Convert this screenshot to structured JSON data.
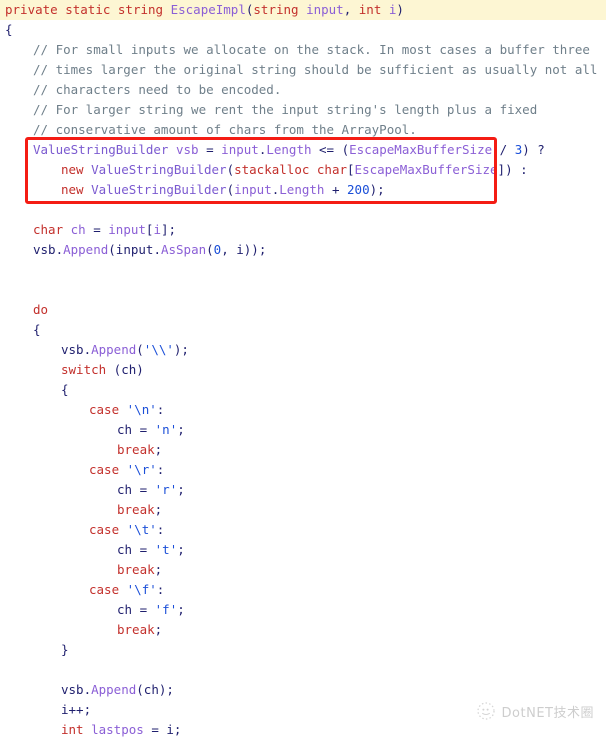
{
  "editor": {
    "language": "csharp",
    "background": "#ffffff",
    "current_line_highlight_color": "#fdf6d3",
    "annotation_box_color": "#f41c14",
    "colors": {
      "keyword": "#c3302c",
      "type": "#7b5ad0",
      "identifier": "#8b5fd6",
      "number": "#1b4fd8",
      "string": "#1b4fd8",
      "comment": "#6f7f8a",
      "punctuation": "#1f1f6e"
    }
  },
  "lines": [
    {
      "highlighted": true,
      "indent": 0,
      "tokens": [
        {
          "t": "private",
          "c": "kw"
        },
        {
          "t": " ",
          "c": "plain"
        },
        {
          "t": "static",
          "c": "kw"
        },
        {
          "t": " ",
          "c": "plain"
        },
        {
          "t": "string",
          "c": "kw"
        },
        {
          "t": " ",
          "c": "plain"
        },
        {
          "t": "EscapeImpl",
          "c": "method"
        },
        {
          "t": "(",
          "c": "punct"
        },
        {
          "t": "string",
          "c": "kw"
        },
        {
          "t": " ",
          "c": "plain"
        },
        {
          "t": "input",
          "c": "ident"
        },
        {
          "t": ", ",
          "c": "punct"
        },
        {
          "t": "int",
          "c": "kw"
        },
        {
          "t": " ",
          "c": "plain"
        },
        {
          "t": "i",
          "c": "ident"
        },
        {
          "t": ")",
          "c": "punct"
        }
      ]
    },
    {
      "highlighted": false,
      "indent": 0,
      "tokens": [
        {
          "t": "{",
          "c": "punct"
        }
      ]
    },
    {
      "highlighted": false,
      "indent": 1,
      "tokens": [
        {
          "t": "// For small inputs we allocate on the stack. In most cases a buffer three",
          "c": "comment"
        }
      ]
    },
    {
      "highlighted": false,
      "indent": 1,
      "tokens": [
        {
          "t": "// times larger the original string should be sufficient as usually not all",
          "c": "comment"
        }
      ]
    },
    {
      "highlighted": false,
      "indent": 1,
      "tokens": [
        {
          "t": "// characters need to be encoded.",
          "c": "comment"
        }
      ]
    },
    {
      "highlighted": false,
      "indent": 1,
      "tokens": [
        {
          "t": "// For larger string we rent the input string's length plus a fixed",
          "c": "comment"
        }
      ]
    },
    {
      "highlighted": false,
      "indent": 1,
      "tokens": [
        {
          "t": "// conservative amount of chars from the ArrayPool.",
          "c": "comment"
        }
      ]
    },
    {
      "highlighted": false,
      "indent": 1,
      "tokens": [
        {
          "t": "ValueStringBuilder",
          "c": "type"
        },
        {
          "t": " ",
          "c": "plain"
        },
        {
          "t": "vsb",
          "c": "ident"
        },
        {
          "t": " ",
          "c": "plain"
        },
        {
          "t": "=",
          "c": "punct"
        },
        {
          "t": " ",
          "c": "plain"
        },
        {
          "t": "input",
          "c": "ident"
        },
        {
          "t": ".",
          "c": "punct"
        },
        {
          "t": "Length",
          "c": "ident"
        },
        {
          "t": " <= (",
          "c": "punct"
        },
        {
          "t": "EscapeMaxBufferSize",
          "c": "ident"
        },
        {
          "t": " / ",
          "c": "punct"
        },
        {
          "t": "3",
          "c": "num"
        },
        {
          "t": ") ?",
          "c": "punct"
        }
      ]
    },
    {
      "highlighted": false,
      "indent": 2,
      "tokens": [
        {
          "t": "new",
          "c": "kw"
        },
        {
          "t": " ",
          "c": "plain"
        },
        {
          "t": "ValueStringBuilder",
          "c": "type"
        },
        {
          "t": "(",
          "c": "punct"
        },
        {
          "t": "stackalloc",
          "c": "kw"
        },
        {
          "t": " ",
          "c": "plain"
        },
        {
          "t": "char",
          "c": "kw"
        },
        {
          "t": "[",
          "c": "punct"
        },
        {
          "t": "EscapeMaxBufferSize",
          "c": "ident"
        },
        {
          "t": "]) :",
          "c": "punct"
        }
      ]
    },
    {
      "highlighted": false,
      "indent": 2,
      "tokens": [
        {
          "t": "new",
          "c": "kw"
        },
        {
          "t": " ",
          "c": "plain"
        },
        {
          "t": "ValueStringBuilder",
          "c": "type"
        },
        {
          "t": "(",
          "c": "punct"
        },
        {
          "t": "input",
          "c": "ident"
        },
        {
          "t": ".",
          "c": "punct"
        },
        {
          "t": "Length",
          "c": "ident"
        },
        {
          "t": " + ",
          "c": "punct"
        },
        {
          "t": "200",
          "c": "num"
        },
        {
          "t": ");",
          "c": "punct"
        }
      ]
    },
    {
      "highlighted": false,
      "indent": 0,
      "tokens": [
        {
          "t": "",
          "c": "plain"
        }
      ]
    },
    {
      "highlighted": false,
      "indent": 1,
      "tokens": [
        {
          "t": "char",
          "c": "kw"
        },
        {
          "t": " ",
          "c": "plain"
        },
        {
          "t": "ch",
          "c": "ident"
        },
        {
          "t": " = ",
          "c": "punct"
        },
        {
          "t": "input",
          "c": "ident"
        },
        {
          "t": "[",
          "c": "punct"
        },
        {
          "t": "i",
          "c": "ident"
        },
        {
          "t": "];",
          "c": "punct"
        }
      ]
    },
    {
      "highlighted": false,
      "indent": 1,
      "tokens": [
        {
          "t": "vsb",
          "c": "plain"
        },
        {
          "t": ".",
          "c": "punct"
        },
        {
          "t": "Append",
          "c": "method"
        },
        {
          "t": "(",
          "c": "punct"
        },
        {
          "t": "input",
          "c": "plain"
        },
        {
          "t": ".",
          "c": "punct"
        },
        {
          "t": "AsSpan",
          "c": "method"
        },
        {
          "t": "(",
          "c": "punct"
        },
        {
          "t": "0",
          "c": "num"
        },
        {
          "t": ", ",
          "c": "punct"
        },
        {
          "t": "i",
          "c": "plain"
        },
        {
          "t": "));",
          "c": "punct"
        }
      ]
    },
    {
      "highlighted": false,
      "indent": 0,
      "tokens": [
        {
          "t": "",
          "c": "plain"
        }
      ]
    },
    {
      "highlighted": false,
      "indent": 0,
      "tokens": [
        {
          "t": "",
          "c": "plain"
        }
      ]
    },
    {
      "highlighted": false,
      "indent": 1,
      "tokens": [
        {
          "t": "do",
          "c": "kw"
        }
      ]
    },
    {
      "highlighted": false,
      "indent": 1,
      "tokens": [
        {
          "t": "{",
          "c": "punct"
        }
      ]
    },
    {
      "highlighted": false,
      "indent": 2,
      "tokens": [
        {
          "t": "vsb",
          "c": "plain"
        },
        {
          "t": ".",
          "c": "punct"
        },
        {
          "t": "Append",
          "c": "method"
        },
        {
          "t": "(",
          "c": "punct"
        },
        {
          "t": "'\\\\'",
          "c": "str"
        },
        {
          "t": ");",
          "c": "punct"
        }
      ]
    },
    {
      "highlighted": false,
      "indent": 2,
      "tokens": [
        {
          "t": "switch",
          "c": "kw"
        },
        {
          "t": " (",
          "c": "punct"
        },
        {
          "t": "ch",
          "c": "plain"
        },
        {
          "t": ")",
          "c": "punct"
        }
      ]
    },
    {
      "highlighted": false,
      "indent": 2,
      "tokens": [
        {
          "t": "{",
          "c": "punct"
        }
      ]
    },
    {
      "highlighted": false,
      "indent": 3,
      "tokens": [
        {
          "t": "case",
          "c": "kw"
        },
        {
          "t": " ",
          "c": "plain"
        },
        {
          "t": "'\\n'",
          "c": "str"
        },
        {
          "t": ":",
          "c": "punct"
        }
      ]
    },
    {
      "highlighted": false,
      "indent": 4,
      "tokens": [
        {
          "t": "ch",
          "c": "plain"
        },
        {
          "t": " = ",
          "c": "punct"
        },
        {
          "t": "'n'",
          "c": "str"
        },
        {
          "t": ";",
          "c": "punct"
        }
      ]
    },
    {
      "highlighted": false,
      "indent": 4,
      "tokens": [
        {
          "t": "break",
          "c": "kw"
        },
        {
          "t": ";",
          "c": "punct"
        }
      ]
    },
    {
      "highlighted": false,
      "indent": 3,
      "tokens": [
        {
          "t": "case",
          "c": "kw"
        },
        {
          "t": " ",
          "c": "plain"
        },
        {
          "t": "'\\r'",
          "c": "str"
        },
        {
          "t": ":",
          "c": "punct"
        }
      ]
    },
    {
      "highlighted": false,
      "indent": 4,
      "tokens": [
        {
          "t": "ch",
          "c": "plain"
        },
        {
          "t": " = ",
          "c": "punct"
        },
        {
          "t": "'r'",
          "c": "str"
        },
        {
          "t": ";",
          "c": "punct"
        }
      ]
    },
    {
      "highlighted": false,
      "indent": 4,
      "tokens": [
        {
          "t": "break",
          "c": "kw"
        },
        {
          "t": ";",
          "c": "punct"
        }
      ]
    },
    {
      "highlighted": false,
      "indent": 3,
      "tokens": [
        {
          "t": "case",
          "c": "kw"
        },
        {
          "t": " ",
          "c": "plain"
        },
        {
          "t": "'\\t'",
          "c": "str"
        },
        {
          "t": ":",
          "c": "punct"
        }
      ]
    },
    {
      "highlighted": false,
      "indent": 4,
      "tokens": [
        {
          "t": "ch",
          "c": "plain"
        },
        {
          "t": " = ",
          "c": "punct"
        },
        {
          "t": "'t'",
          "c": "str"
        },
        {
          "t": ";",
          "c": "punct"
        }
      ]
    },
    {
      "highlighted": false,
      "indent": 4,
      "tokens": [
        {
          "t": "break",
          "c": "kw"
        },
        {
          "t": ";",
          "c": "punct"
        }
      ]
    },
    {
      "highlighted": false,
      "indent": 3,
      "tokens": [
        {
          "t": "case",
          "c": "kw"
        },
        {
          "t": " ",
          "c": "plain"
        },
        {
          "t": "'\\f'",
          "c": "str"
        },
        {
          "t": ":",
          "c": "punct"
        }
      ]
    },
    {
      "highlighted": false,
      "indent": 4,
      "tokens": [
        {
          "t": "ch",
          "c": "plain"
        },
        {
          "t": " = ",
          "c": "punct"
        },
        {
          "t": "'f'",
          "c": "str"
        },
        {
          "t": ";",
          "c": "punct"
        }
      ]
    },
    {
      "highlighted": false,
      "indent": 4,
      "tokens": [
        {
          "t": "break",
          "c": "kw"
        },
        {
          "t": ";",
          "c": "punct"
        }
      ]
    },
    {
      "highlighted": false,
      "indent": 2,
      "tokens": [
        {
          "t": "}",
          "c": "punct"
        }
      ]
    },
    {
      "highlighted": false,
      "indent": 0,
      "tokens": [
        {
          "t": "",
          "c": "plain"
        }
      ]
    },
    {
      "highlighted": false,
      "indent": 2,
      "tokens": [
        {
          "t": "vsb",
          "c": "plain"
        },
        {
          "t": ".",
          "c": "punct"
        },
        {
          "t": "Append",
          "c": "method"
        },
        {
          "t": "(",
          "c": "punct"
        },
        {
          "t": "ch",
          "c": "plain"
        },
        {
          "t": ");",
          "c": "punct"
        }
      ]
    },
    {
      "highlighted": false,
      "indent": 2,
      "tokens": [
        {
          "t": "i",
          "c": "plain"
        },
        {
          "t": "++;",
          "c": "punct"
        }
      ]
    },
    {
      "highlighted": false,
      "indent": 2,
      "tokens": [
        {
          "t": "int",
          "c": "kw"
        },
        {
          "t": " ",
          "c": "plain"
        },
        {
          "t": "lastpos",
          "c": "ident"
        },
        {
          "t": " = ",
          "c": "punct"
        },
        {
          "t": "i",
          "c": "plain"
        },
        {
          "t": ";",
          "c": "punct"
        }
      ]
    }
  ],
  "annotation": {
    "name": "red-highlight-box",
    "color": "#f41c14",
    "covers_lines": [
      8,
      9,
      10
    ]
  },
  "watermark": {
    "text": "DotNET技术圈",
    "logo_icon": "wechat-dotted-circle-icon"
  }
}
